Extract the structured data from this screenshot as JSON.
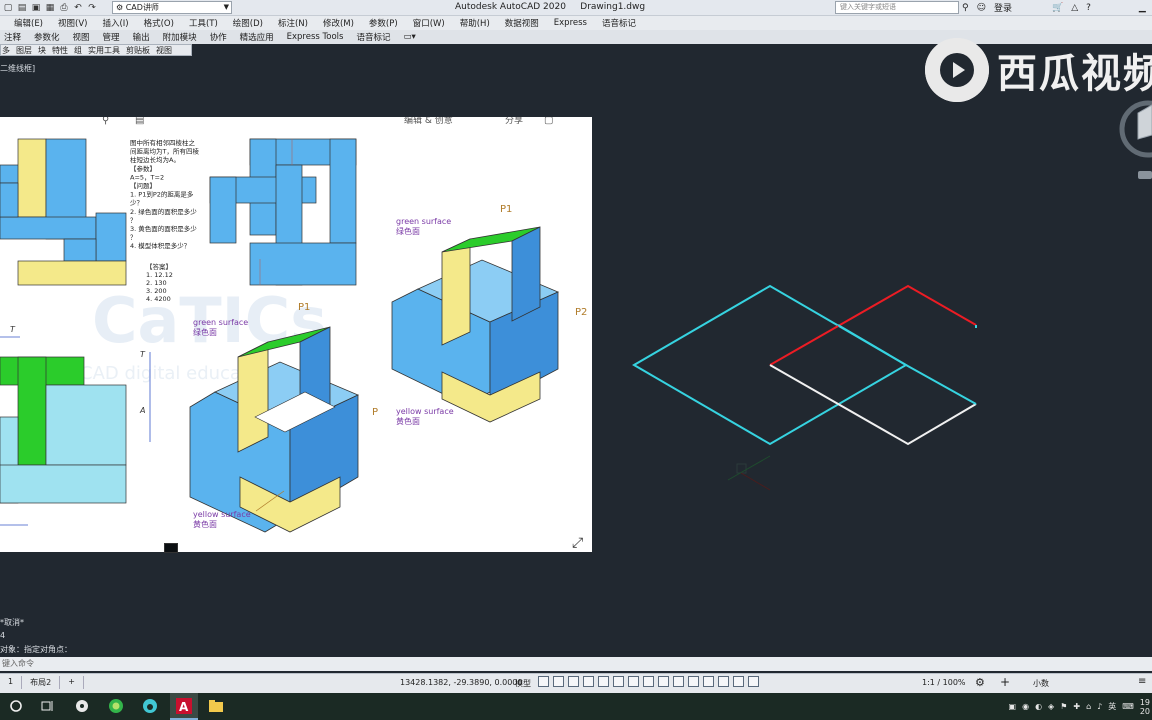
{
  "titlebar": {
    "workspace": "CAD讲师",
    "app_title": "Autodesk AutoCAD 2020",
    "file_name": "Drawing1.dwg",
    "search_placeholder": "键入关键字或短语",
    "login": "登录"
  },
  "menu": [
    "编辑(E)",
    "视图(V)",
    "插入(I)",
    "格式(O)",
    "工具(T)",
    "绘图(D)",
    "标注(N)",
    "修改(M)",
    "参数(P)",
    "窗口(W)",
    "帮助(H)",
    "数据视图",
    "Express",
    "语音标记"
  ],
  "ribbon_tabs": [
    "注释",
    "参数化",
    "视图",
    "管理",
    "输出",
    "附加模块",
    "协作",
    "精选应用",
    "Express Tools",
    "语音标记"
  ],
  "panel_tabs": [
    "多",
    "图层",
    "块",
    "特性",
    "组",
    "实用工具",
    "剪贴板",
    "视图"
  ],
  "view_label": "二维线框]",
  "watermark": {
    "text": "西瓜视频"
  },
  "pasted_image": {
    "question": [
      "图中所有相邻四棱柱之",
      "间距离均为T，所有四棱",
      "柱短边长均为A。",
      "【参数】",
      "A=5，T=2",
      "【问题】",
      "1. P1到P2的距离是多",
      "少？",
      "2. 绿色面的面积是多少",
      "？",
      "3. 黄色面的面积是多少",
      "？",
      "4. 模型体积是多少？"
    ],
    "answers_title": "【答案】",
    "answers": [
      "1. 12.12",
      "2. 130",
      "3. 200",
      "4. 4200"
    ],
    "labels": {
      "green_en": "green surface",
      "green_cn": "绿色面",
      "yellow_en": "yellow surface",
      "yellow_cn": "黄色面",
      "p1": "P1",
      "p2": "P2",
      "p": "P",
      "t": "T",
      "a": "A"
    },
    "bg_watermark": "CaTICs",
    "bg_watermark2": "CAD digital education",
    "toolbar_text": [
      "编辑 & 创意",
      "分享"
    ]
  },
  "command_history": [
    "*取消*",
    "4",
    "对象：指定对角点："
  ],
  "command_placeholder": "键入命令",
  "status": {
    "tabs": [
      "1",
      "布局2",
      "+"
    ],
    "coords": "13428.1382, -29.3890, 0.0000",
    "model": "模型",
    "scale": "1:1 / 100%",
    "units": "小数"
  },
  "taskbar": {
    "time": "19",
    "date": "20",
    "lang": "英"
  },
  "colors": {
    "cyan": "#36d3e0",
    "red": "#ec1c24",
    "white": "#f0f0f0",
    "blue_face": "#5ab3ee",
    "green_face": "#2bcc2b",
    "yellow_face": "#f4e98a"
  }
}
